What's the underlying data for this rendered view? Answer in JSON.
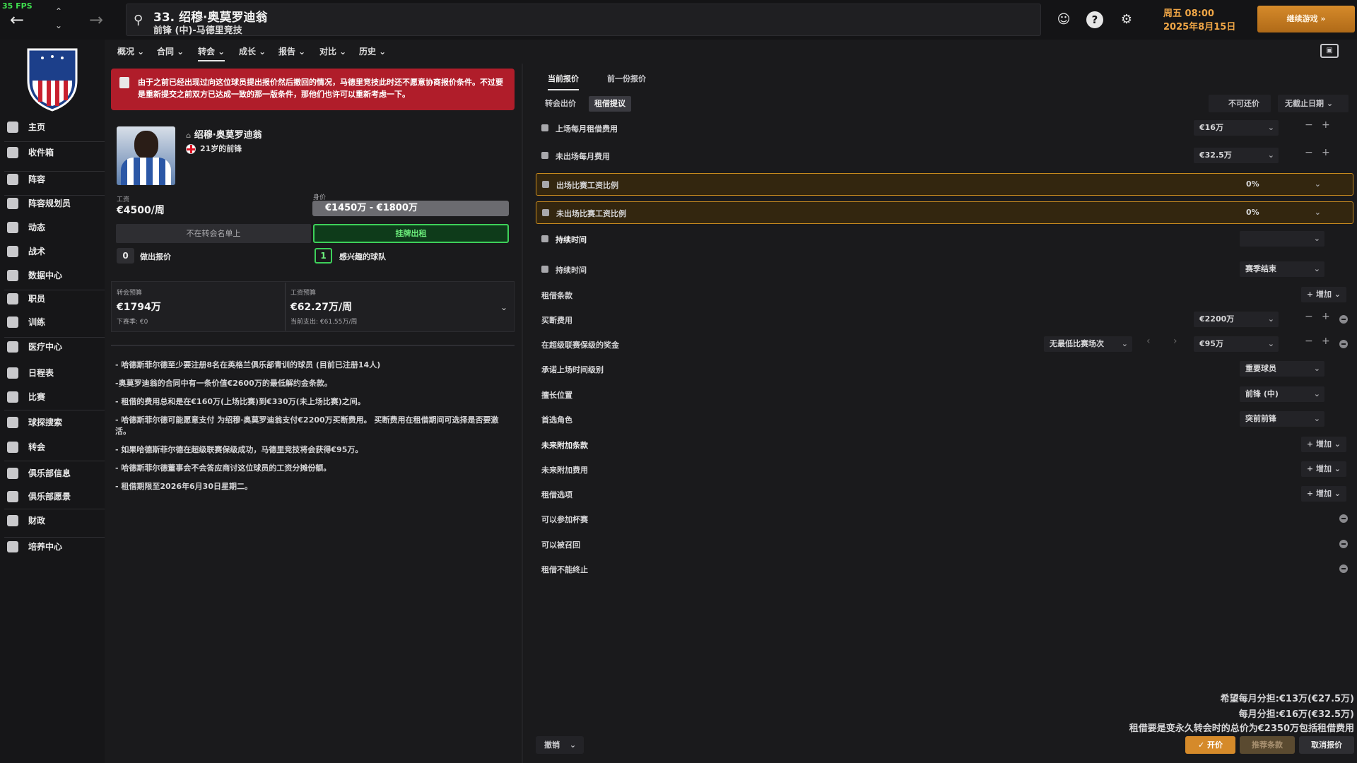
{
  "fps": "35 FPS",
  "header": {
    "title": "33. 绍穆·奥莫罗迪翁",
    "subtitle": "前锋 (中)-马德里竞技",
    "date_line1": "周五 08:00",
    "date_line2": "2025年8月15日",
    "continue": "继续游戏 »"
  },
  "sidebar": {
    "items": [
      "主页",
      "收件箱",
      "阵容",
      "阵容规划员",
      "动态",
      "战术",
      "数据中心",
      "职员",
      "训练",
      "医疗中心",
      "日程表",
      "比赛",
      "球探搜索",
      "转会",
      "俱乐部信息",
      "俱乐部愿景",
      "财政",
      "培养中心"
    ]
  },
  "menu": [
    "概况 ⌄",
    "合同 ⌄",
    "转会 ⌄",
    "成长 ⌄",
    "报告 ⌄",
    "对比 ⌄",
    "历史 ⌄"
  ],
  "menu_active": 2,
  "alert": "由于之前已经出现过向这位球员提出报价然后撤回的情况，马德里竞技此时还不愿意协商报价条件。不过要是重新提交之前双方已达成一致的那一版条件，那他们也许可以重新考虑一下。",
  "player": {
    "name": "绍穆·奥莫罗迪翁",
    "age_pos": "21岁的前锋",
    "wage_label": "工资",
    "wage": "€4500/周",
    "value_label": "身价",
    "value": "€1450万 - €1800万",
    "not_listed": "不在转会名单上",
    "loan_listed": "挂牌出租",
    "offers_count": "0",
    "offers_label": "做出报价",
    "interested_count": "1",
    "interested_label": "感兴趣的球队"
  },
  "budget": {
    "transfer_label": "转会预算",
    "transfer": "€1794万",
    "transfer_next": "下赛季: €0",
    "wage_label": "工资预算",
    "wage": "€62.27万/周",
    "wage_current": "当前支出: €61.55万/周"
  },
  "notes": [
    "- 哈德斯菲尔德至少要注册8名在英格兰俱乐部青训的球员 (目前已注册14人)",
    "-奥莫罗迪翁的合同中有一条价值€2600万的最低解约金条款。",
    "- 租借的费用总和是在€160万(上场比赛)到€330万(未上场比赛)之间。",
    "- 哈德斯菲尔德可能愿意支付 为绍穆·奥莫罗迪翁支付€2200万买断费用。 买断费用在租借期间可选择是否要激活。",
    "- 如果哈德斯菲尔德在超级联赛保级成功，马德里竞技将会获得€95万。",
    "- 哈德斯菲尔德董事会不会答应商讨这位球员的工资分摊份额。",
    "- 租借期限至2026年6月30日星期二。"
  ],
  "offer_tabs": [
    "当前报价",
    "前一份报价"
  ],
  "sub_tabs": [
    "转会出价",
    "租借提议"
  ],
  "header_buttons": {
    "no_counter": "不可还价",
    "no_deadline": "无截止日期 ⌄"
  },
  "rows": [
    {
      "label": "上场每月租借费用",
      "value": "€16万"
    },
    {
      "label": "未出场每月费用",
      "value": "€32.5万"
    },
    {
      "label": "出场比赛工资比例",
      "value": "0%"
    },
    {
      "label": "未出场比赛工资比例",
      "value": "0%"
    },
    {
      "label": "持续时间",
      "value": ""
    },
    {
      "label": "持续时间",
      "value": "赛季结束"
    },
    {
      "label": "租借条款",
      "value": ""
    },
    {
      "label": "买断费用",
      "value": "€2200万"
    },
    {
      "label": "在超级联赛保级的奖金",
      "value": "€95万",
      "extra": "无最低比赛场次"
    },
    {
      "label": "承诺上场时间级别",
      "value": "重要球员"
    },
    {
      "label": "擅长位置",
      "value": "前锋 (中)"
    },
    {
      "label": "首选角色",
      "value": "突前前锋"
    },
    {
      "label": "未来附加条款",
      "value": ""
    },
    {
      "label": "未来附加费用",
      "value": ""
    },
    {
      "label": "租借选项",
      "value": ""
    },
    {
      "label": "可以参加杯赛",
      "value": ""
    },
    {
      "label": "可以被召回",
      "value": ""
    },
    {
      "label": "租借不能终止",
      "value": ""
    }
  ],
  "add_label": "+ 增加 ⌄",
  "summary": [
    "希望每月分担:€13万(€27.5万)",
    "每月分担:€16万(€32.5万)",
    "租借要是变永久转会时的总价为€2350万包括租借费用"
  ],
  "bottom": {
    "undo": "撤销",
    "offer": "✓ 开价",
    "suggest": "推荐条款",
    "cancel": "取消报价"
  },
  "colors": {
    "accent": "#d58a2a",
    "alert": "#b01d2a",
    "green": "#3ed05a"
  }
}
